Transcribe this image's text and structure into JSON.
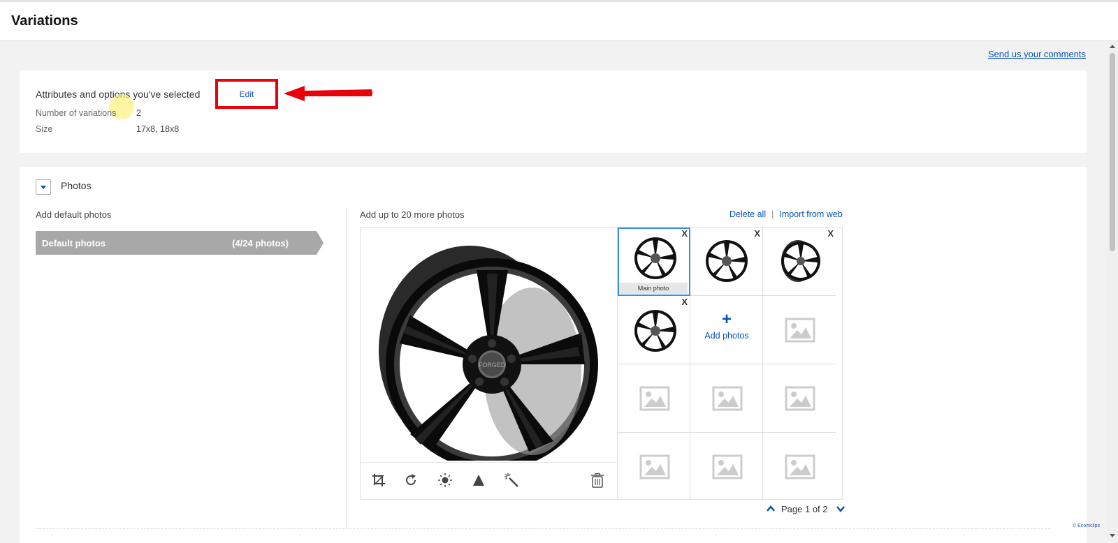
{
  "header": {
    "title": "Variations"
  },
  "feedback_link": "Send us your comments",
  "attributes": {
    "title": "Attributes and options you've selected",
    "edit_label": "Edit",
    "rows": [
      {
        "label": "Number of variations",
        "value": "2"
      },
      {
        "label": "Size",
        "value": "17x8, 18x8"
      }
    ]
  },
  "photos": {
    "section_title": "Photos",
    "add_default_label": "Add default photos",
    "default_bar": {
      "label": "Default photos",
      "count": "(4/24 photos)"
    },
    "add_more_label": "Add up to 20 more photos",
    "delete_all": "Delete all",
    "import_web": "Import from web",
    "separator": "|",
    "main_photo_label": "Main photo",
    "remove_symbol": "X",
    "add_photos_symbol": "+",
    "add_photos_label": "Add photos",
    "hub_text": "FORGED",
    "tools": [
      "crop-icon",
      "rotate-icon",
      "brightness-icon",
      "contrast-icon",
      "auto-enhance-icon",
      "delete-icon"
    ],
    "pager": "Page 1 of 2"
  },
  "watermark": "© Ecomclips",
  "colors": {
    "link": "#0654ba",
    "highlight_box": "#e8000b",
    "bar": "#a8a8a8",
    "selected": "#3b8fd9"
  }
}
